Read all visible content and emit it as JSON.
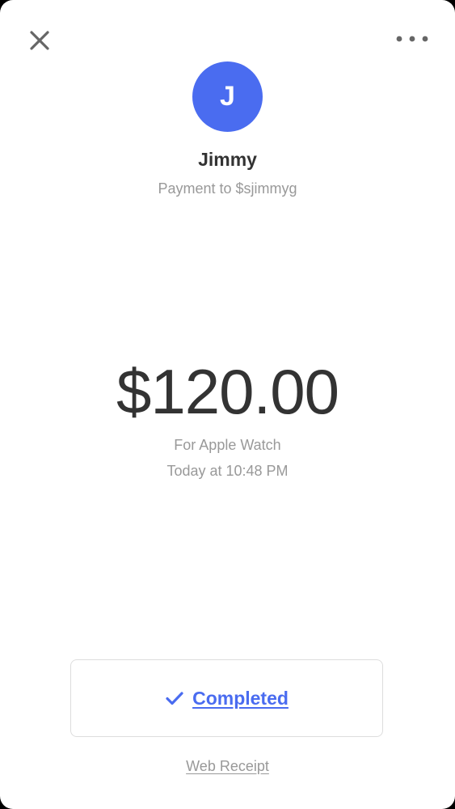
{
  "colors": {
    "accent": "#4A6CF0",
    "avatar_bg": "#4A6CF0",
    "icon_gray": "#666666"
  },
  "header": {
    "close_icon": "close-icon",
    "more_icon": "more-horizontal-icon"
  },
  "recipient": {
    "initial": "J",
    "name": "Jimmy",
    "subtitle": "Payment to $sjimmyg"
  },
  "payment": {
    "amount": "$120.00",
    "note": "For Apple Watch",
    "time": "Today at 10:48 PM"
  },
  "status": {
    "icon": "checkmark-icon",
    "label": "Completed"
  },
  "footer": {
    "receipt_link": "Web Receipt"
  }
}
